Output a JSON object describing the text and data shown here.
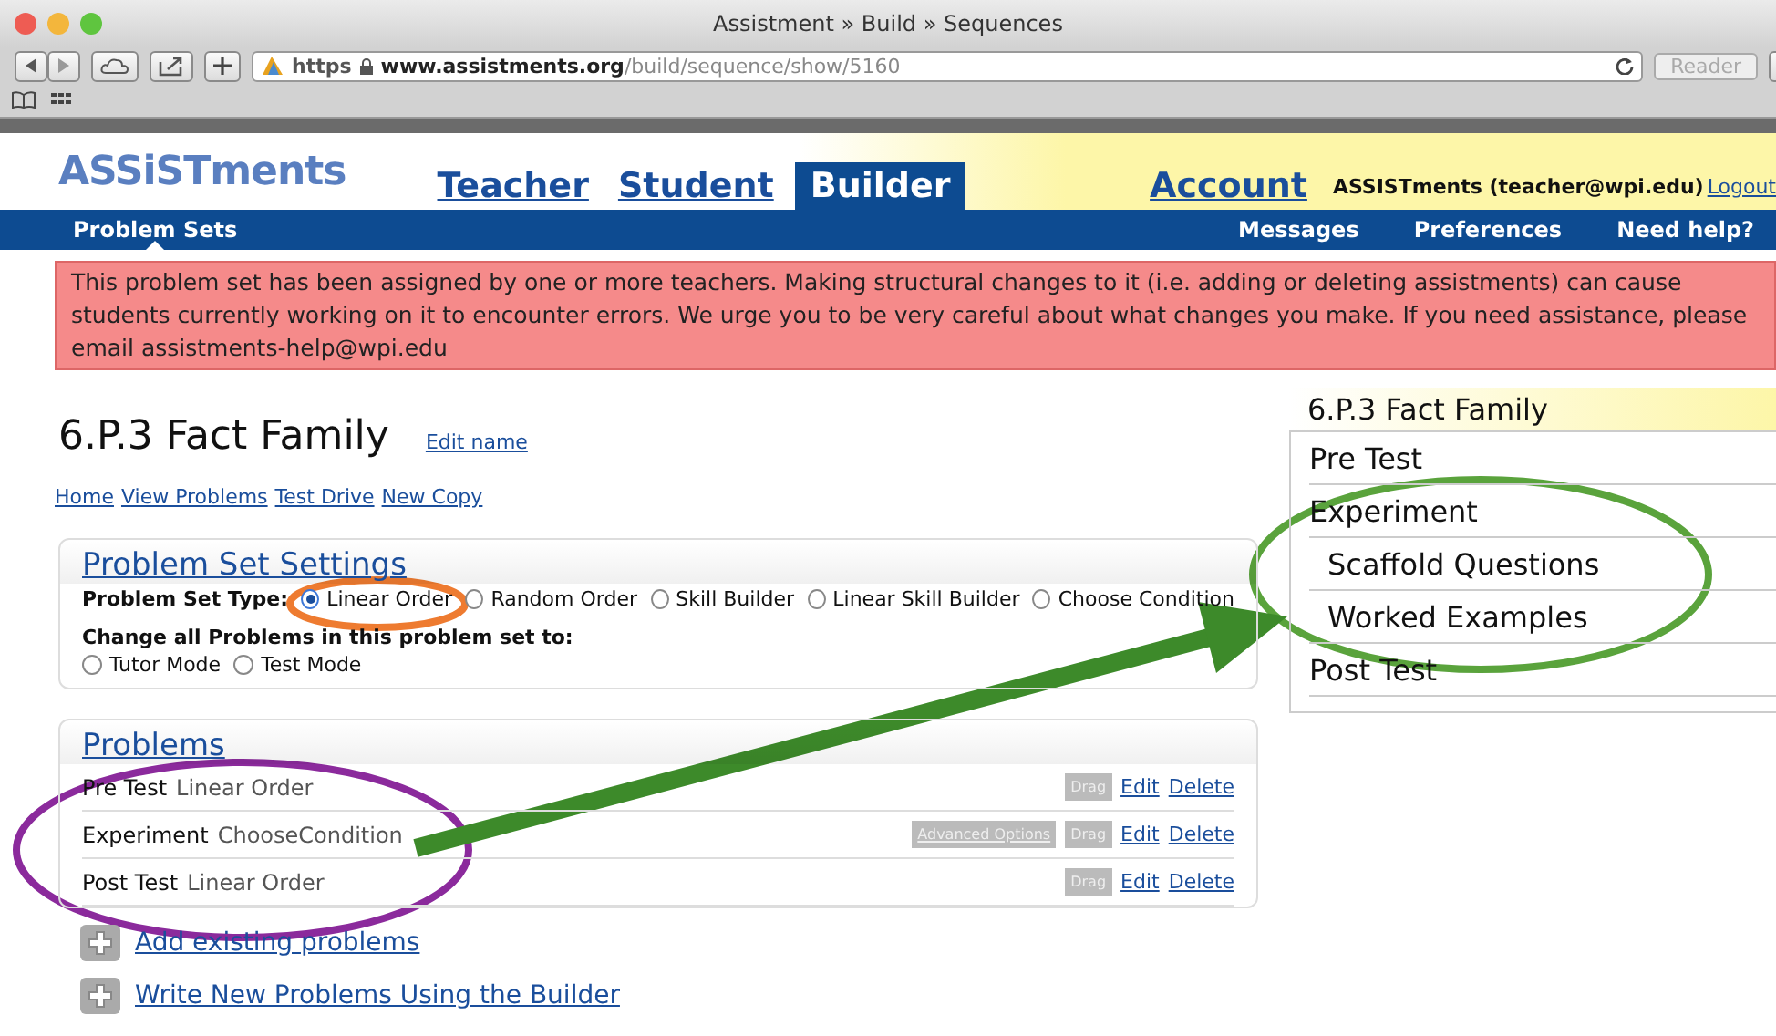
{
  "browser": {
    "title": "Assistment » Build » Sequences",
    "url_scheme": "https",
    "url_host": "www.assistments.org",
    "url_path": "/build/sequence/show/5160",
    "reader_button": "Reader"
  },
  "header": {
    "logo": "ASSiSTments",
    "tabs": [
      {
        "label": "Teacher",
        "selected": false
      },
      {
        "label": "Student",
        "selected": false
      },
      {
        "label": "Builder",
        "selected": true
      }
    ],
    "account": "Account",
    "user": "ASSISTments (teacher@wpi.edu)",
    "logout": "Logout"
  },
  "nav": {
    "left": [
      {
        "label": "Problem Sets",
        "selected": true
      }
    ],
    "right": [
      "Messages",
      "Preferences",
      "Need help?"
    ]
  },
  "alert": "This problem set has been assigned by one or more teachers. Making structural changes to it (i.e. adding or deleting assistments) can cause students currently working on it to encounter errors. We urge you to be very careful about what changes you make. If you need assistance, please email assistments-help@wpi.edu",
  "title": "6.P.3 Fact Family",
  "edit_name": "Edit name",
  "links": [
    "Home",
    "View Problems",
    "Test Drive",
    "New Copy"
  ],
  "settings": {
    "heading": "Problem Set Settings",
    "type_label": "Problem Set Type:",
    "types": [
      {
        "label": "Linear Order",
        "selected": true
      },
      {
        "label": "Random Order",
        "selected": false
      },
      {
        "label": "Skill Builder",
        "selected": false
      },
      {
        "label": "Linear Skill Builder",
        "selected": false
      },
      {
        "label": "Choose Condition",
        "selected": false
      }
    ],
    "change_label": "Change all Problems in this problem set to:",
    "modes": [
      {
        "label": "Tutor Mode",
        "selected": false
      },
      {
        "label": "Test Mode",
        "selected": false
      }
    ]
  },
  "problems": {
    "heading": "Problems",
    "rows": [
      {
        "name": "Pre Test",
        "type": "Linear Order",
        "drag": "Drag",
        "edit": "Edit",
        "delete": "Delete"
      },
      {
        "name": "Experiment",
        "type": "ChooseCondition",
        "advanced": "Advanced Options",
        "drag": "Drag",
        "edit": "Edit",
        "delete": "Delete"
      },
      {
        "name": "Post Test",
        "type": "Linear Order",
        "drag": "Drag",
        "edit": "Edit",
        "delete": "Delete"
      }
    ],
    "add_links": [
      "Add existing problems",
      "Write New Problems Using the Builder"
    ]
  },
  "sidebar": {
    "title": "6.P.3 Fact Family",
    "tree": [
      {
        "label": "Pre Test"
      },
      {
        "label": "Experiment",
        "children": [
          {
            "label": "Scaffold Questions"
          },
          {
            "label": "Worked Examples"
          }
        ]
      },
      {
        "label": "Post Test"
      }
    ]
  }
}
